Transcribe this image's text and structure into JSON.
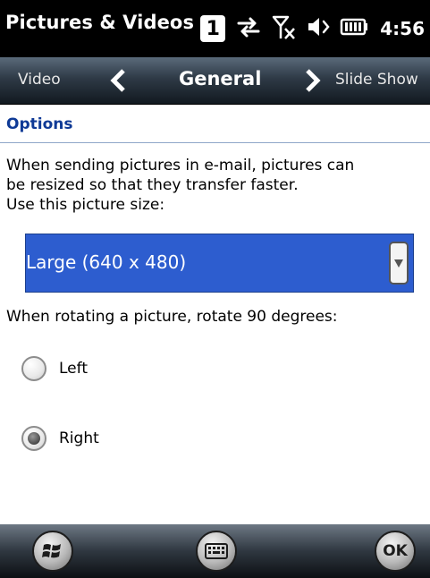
{
  "status_bar": {
    "app_title": "Pictures & Videos",
    "notification_count": "1",
    "time": "4:56",
    "icons": [
      "notification-badge-icon",
      "connectivity-icon",
      "no-signal-icon",
      "speaker-icon",
      "battery-icon"
    ]
  },
  "tabs": {
    "previous": "Video",
    "current": "General",
    "next": "Slide Show"
  },
  "section": {
    "title": "Options"
  },
  "content": {
    "description_lines": [
      "When sending pictures in e-mail, pictures can",
      "be resized so that they transfer faster.",
      "Use this picture size:"
    ],
    "picture_size_value": "Large (640 x 480)",
    "rotate_label": "When rotating a picture, rotate 90 degrees:",
    "rotate_options": [
      {
        "label": "Left",
        "selected": false
      },
      {
        "label": "Right",
        "selected": true
      }
    ]
  },
  "bottom_bar": {
    "start_icon": "windows-start-icon",
    "keyboard_icon": "keyboard-icon",
    "ok_label": "OK"
  },
  "colors": {
    "section_title": "#0f3a96",
    "select_highlight": "#2d5dcf",
    "status_bar_bg": "#000000"
  }
}
